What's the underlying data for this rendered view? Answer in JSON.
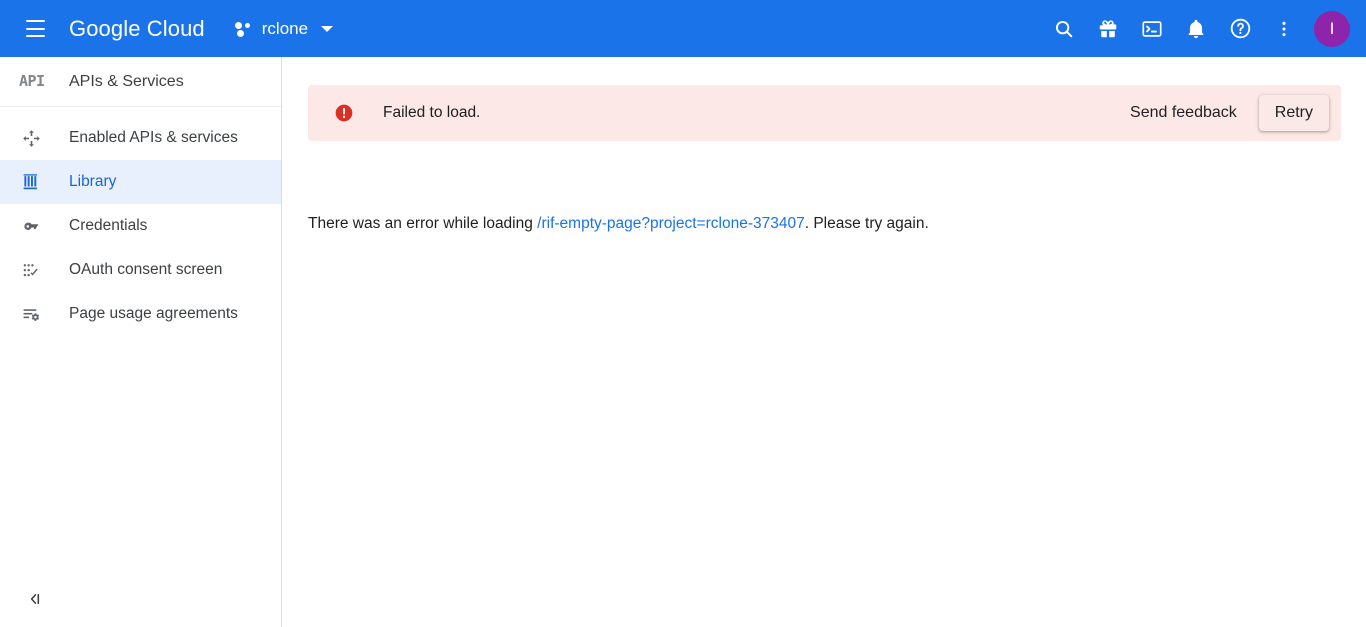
{
  "topbar": {
    "menu_icon": "hamburger-menu-icon",
    "brand": "Google Cloud",
    "project_name": "rclone",
    "project_icon": "project-dots-icon",
    "dropdown_icon": "chevron-down-icon",
    "actions": [
      {
        "name": "search-icon",
        "label": "Search"
      },
      {
        "name": "gift-icon",
        "label": "What's new"
      },
      {
        "name": "cloud-shell-icon",
        "label": "Activate Cloud Shell"
      },
      {
        "name": "notifications-bell-icon",
        "label": "Notifications"
      },
      {
        "name": "help-icon",
        "label": "Support"
      },
      {
        "name": "more-vert-icon",
        "label": "Settings and utilities"
      }
    ],
    "avatar_initial": "I"
  },
  "sidebar": {
    "logo_text": "API",
    "title": "APIs & Services",
    "items": [
      {
        "label": "Enabled APIs & services",
        "icon": "enabled-apis-icon",
        "active": false
      },
      {
        "label": "Library",
        "icon": "library-icon",
        "active": true
      },
      {
        "label": "Credentials",
        "icon": "key-icon",
        "active": false
      },
      {
        "label": "OAuth consent screen",
        "icon": "oauth-consent-icon",
        "active": false
      },
      {
        "label": "Page usage agreements",
        "icon": "page-usage-icon",
        "active": false
      }
    ],
    "collapse_label": "Collapse navigation",
    "collapse_icon": "collapse-panel-icon"
  },
  "main": {
    "banner": {
      "icon": "error-circle-icon",
      "message": "Failed to load.",
      "send_feedback_label": "Send feedback",
      "retry_label": "Retry"
    },
    "error_detail": {
      "prefix": "There was an error while loading ",
      "link_text": "/rif-empty-page?project=rclone-373407",
      "suffix": ". Please try again."
    }
  },
  "colors": {
    "header_blue": "#1a73e8",
    "link_blue": "#1a73e8",
    "active_nav_blue": "#1967d2",
    "active_nav_bg": "#e8f0fe",
    "banner_bg": "#fce8e6",
    "error_red": "#d93025",
    "avatar_purple": "#8e24aa"
  }
}
